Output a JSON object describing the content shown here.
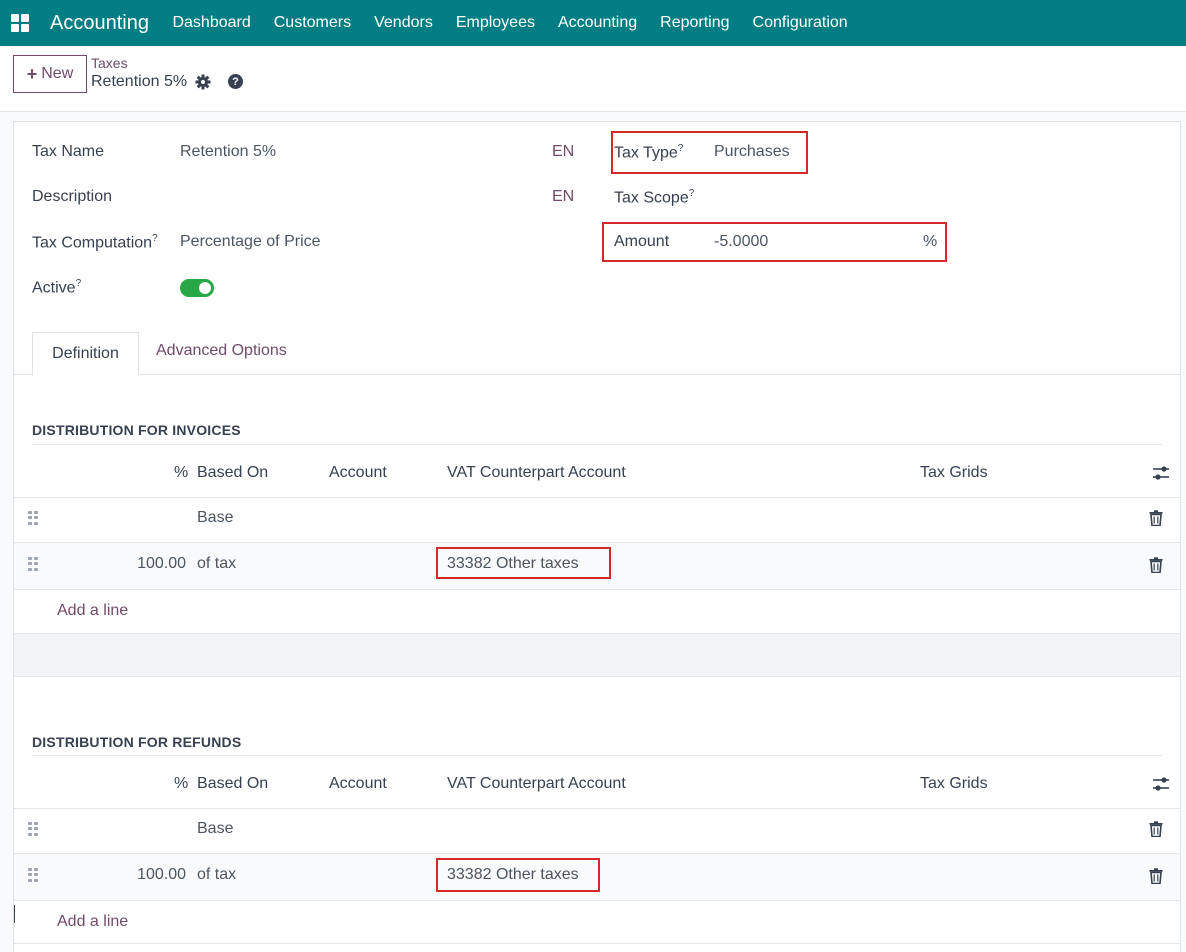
{
  "nav": {
    "brand": "Accounting",
    "menu": [
      "Dashboard",
      "Customers",
      "Vendors",
      "Employees",
      "Accounting",
      "Reporting",
      "Configuration"
    ]
  },
  "control_panel": {
    "new_label": "New",
    "breadcrumb_parent": "Taxes",
    "breadcrumb_current": "Retention 5%"
  },
  "form": {
    "tax_name_label": "Tax Name",
    "tax_name_value": "Retention 5%",
    "description_label": "Description",
    "tax_computation_label": "Tax Computation",
    "tax_computation_value": "Percentage of Price",
    "active_label": "Active",
    "active_value": true,
    "lang_code": "EN",
    "tax_type_label": "Tax Type",
    "tax_type_value": "Purchases",
    "tax_scope_label": "Tax Scope",
    "amount_label": "Amount",
    "amount_value": "-5.0000",
    "amount_unit": "%",
    "help_mark": "?"
  },
  "tabs": [
    "Definition",
    "Advanced Options"
  ],
  "columns": {
    "pct": "%",
    "based_on": "Based On",
    "account": "Account",
    "vat_counterpart": "VAT Counterpart Account",
    "tax_grids": "Tax Grids"
  },
  "invoices": {
    "title": "DISTRIBUTION FOR INVOICES",
    "rows": [
      {
        "pct": "",
        "based_on": "Base",
        "account": "",
        "vat": "",
        "grids": ""
      },
      {
        "pct": "100.00",
        "based_on": "of tax",
        "account": "",
        "vat": "33382 Other taxes",
        "grids": ""
      }
    ],
    "add_line": "Add a line"
  },
  "refunds": {
    "title": "DISTRIBUTION FOR REFUNDS",
    "rows": [
      {
        "pct": "",
        "based_on": "Base",
        "account": "",
        "vat": "",
        "grids": ""
      },
      {
        "pct": "100.00",
        "based_on": "of tax",
        "account": "",
        "vat": "33382 Other taxes",
        "grids": ""
      }
    ],
    "add_line": "Add a line"
  },
  "colors": {
    "nav": "#017e84",
    "accent": "#714b67",
    "highlight": "#d62828",
    "toggle_on": "#28a745"
  }
}
